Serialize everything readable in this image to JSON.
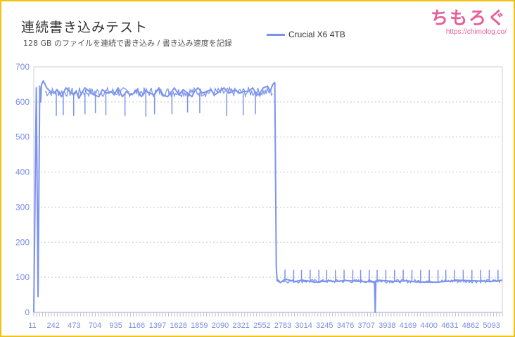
{
  "header": {
    "title": "連続書き込みテスト",
    "subtitle": "128 GB のファイルを連続で書き込み / 書き込み速度を記録"
  },
  "brand": {
    "logo_text": "ちもろぐ",
    "url": "https://chimolog.co/"
  },
  "colors": {
    "series": "#7b93ee",
    "border": "#f2c311",
    "brand": "#e8609a",
    "tick_text": "#7b8ee6"
  },
  "chart_data": {
    "type": "line",
    "title": "連続書き込みテスト",
    "subtitle": "128 GB のファイルを連続で書き込み / 書き込み速度を記録",
    "xlabel": "",
    "ylabel": "",
    "ylim": [
      0,
      700
    ],
    "y_ticks": [
      0,
      100,
      200,
      300,
      400,
      500,
      600,
      700
    ],
    "x_tick_labels": [
      "11",
      "242",
      "473",
      "704",
      "935",
      "1166",
      "1397",
      "1628",
      "1859",
      "2090",
      "2321",
      "2552",
      "2783",
      "3014",
      "3245",
      "3476",
      "3707",
      "3938",
      "4169",
      "4400",
      "4631",
      "4862",
      "5093"
    ],
    "xlim": [
      11,
      5400
    ],
    "grid": true,
    "legend_position": "top",
    "series": [
      {
        "name": "Crucial X6 4TB",
        "color": "#7b93ee",
        "x": [
          11,
          40,
          60,
          80,
          90,
          100,
          120,
          160,
          200,
          242,
          280,
          330,
          380,
          420,
          473,
          500,
          530,
          560,
          600,
          650,
          704,
          760,
          800,
          850,
          900,
          935,
          980,
          1030,
          1080,
          1120,
          1166,
          1200,
          1250,
          1300,
          1350,
          1397,
          1450,
          1500,
          1550,
          1600,
          1628,
          1680,
          1730,
          1780,
          1830,
          1859,
          1900,
          1950,
          2000,
          2050,
          2090,
          2150,
          2200,
          2250,
          2300,
          2321,
          2380,
          2430,
          2480,
          2530,
          2552,
          2600,
          2650,
          2700,
          2730,
          2760,
          2783,
          2800,
          2810,
          2850,
          2900,
          3014,
          3100,
          3245,
          3400,
          3476,
          3600,
          3707,
          3900,
          3930,
          3938,
          3946,
          3960,
          4169,
          4300,
          4400,
          4631,
          4800,
          4862,
          5093,
          5250,
          5350,
          5400
        ],
        "y": [
          0,
          640,
          45,
          645,
          600,
          650,
          660,
          640,
          630,
          625,
          635,
          615,
          640,
          630,
          620,
          630,
          610,
          625,
          640,
          630,
          620,
          615,
          635,
          625,
          630,
          620,
          640,
          615,
          630,
          620,
          625,
          635,
          615,
          630,
          625,
          620,
          640,
          620,
          615,
          630,
          640,
          620,
          635,
          625,
          615,
          630,
          640,
          625,
          630,
          635,
          620,
          630,
          640,
          625,
          630,
          635,
          625,
          630,
          630,
          640,
          630,
          620,
          640,
          645,
          630,
          650,
          655,
          130,
          90,
          85,
          95,
          88,
          92,
          86,
          90,
          88,
          91,
          89,
          87,
          88,
          0,
          90,
          92,
          88,
          90,
          87,
          86,
          89,
          92,
          90,
          88,
          90,
          92
        ],
        "spikes_down": [
          [
            270,
            560
          ],
          [
            350,
            562
          ],
          [
            470,
            560
          ],
          [
            600,
            565
          ],
          [
            720,
            568
          ],
          [
            840,
            562
          ],
          [
            1060,
            560
          ],
          [
            1300,
            558
          ],
          [
            1400,
            565
          ],
          [
            1600,
            565
          ],
          [
            1780,
            570
          ],
          [
            1920,
            568
          ],
          [
            2230,
            560
          ],
          [
            2420,
            562
          ],
          [
            2560,
            565
          ]
        ],
        "spikes_up": [
          [
            2900,
            122
          ],
          [
            3000,
            121
          ],
          [
            3090,
            121
          ],
          [
            3190,
            121
          ],
          [
            3290,
            121
          ],
          [
            3380,
            121
          ],
          [
            3480,
            121
          ],
          [
            3580,
            121
          ],
          [
            3680,
            121
          ],
          [
            3770,
            121
          ],
          [
            3870,
            121
          ],
          [
            3960,
            121
          ],
          [
            4060,
            121
          ],
          [
            4160,
            121
          ],
          [
            4260,
            121
          ],
          [
            4360,
            121
          ],
          [
            4460,
            121
          ],
          [
            4560,
            121
          ],
          [
            4660,
            121
          ],
          [
            4750,
            121
          ],
          [
            4850,
            121
          ],
          [
            4950,
            121
          ],
          [
            5050,
            121
          ],
          [
            5150,
            121
          ],
          [
            5250,
            121
          ],
          [
            5350,
            121
          ]
        ]
      }
    ]
  }
}
